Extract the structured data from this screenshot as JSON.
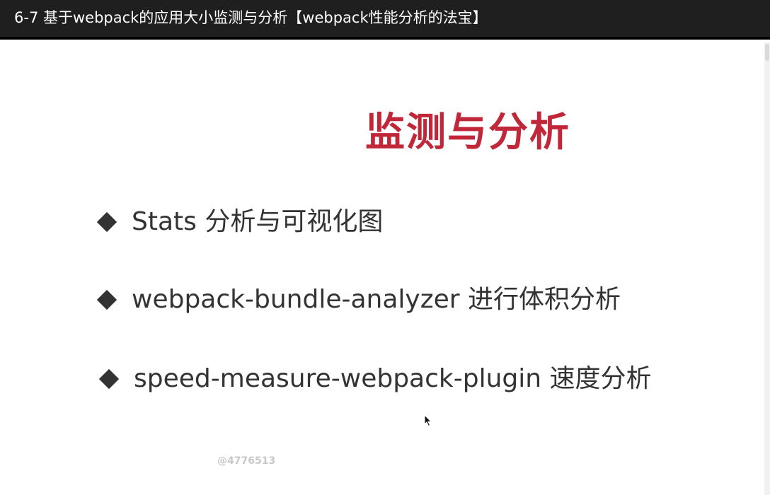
{
  "window": {
    "title": "6-7 基于webpack的应用大小监测与分析【webpack性能分析的法宝】"
  },
  "slide": {
    "heading": "监测与分析",
    "bullets": [
      {
        "icon": "diamond-bullet-icon",
        "text": "Stats 分析与可视化图"
      },
      {
        "icon": "diamond-bullet-icon",
        "text": "webpack-bundle-analyzer 进行体积分析"
      },
      {
        "icon": "diamond-bullet-icon",
        "text": "speed-measure-webpack-plugin 速度分析"
      }
    ],
    "watermark": "@4776513"
  },
  "colors": {
    "heading": "#c0283a",
    "text": "#333333",
    "topbar": "#1f1f1f"
  }
}
